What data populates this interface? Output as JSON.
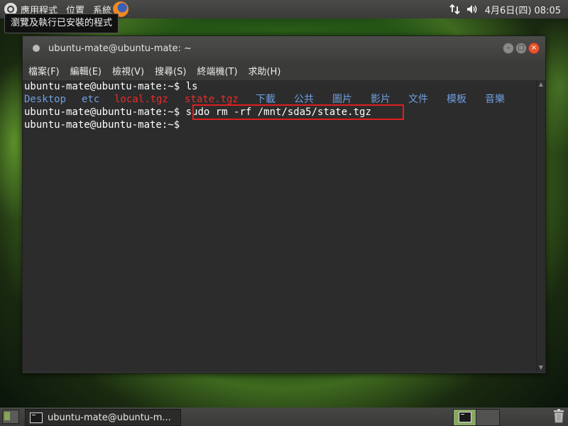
{
  "top_panel": {
    "menus": [
      "應用程式",
      "位置",
      "系統"
    ],
    "tooltip": "瀏覽及執行已安裝的程式",
    "clock": "4月6日(四) 08:05"
  },
  "window": {
    "title": "ubuntu-mate@ubuntu-mate: ~",
    "menu": [
      "檔案(F)",
      "編輯(E)",
      "檢視(V)",
      "搜尋(S)",
      "終端機(T)",
      "求助(H)"
    ]
  },
  "terminal": {
    "prompt": "ubuntu-mate@ubuntu-mate:~$",
    "cmd1": " ls",
    "ls_output": [
      {
        "name": "Desktop",
        "color": "#6f9fe0"
      },
      {
        "name": "etc",
        "color": "#6f9fe0"
      },
      {
        "name": "local.tgz",
        "color": "#ee2a2a"
      },
      {
        "name": "state.tgz",
        "color": "#ee2a2a"
      },
      {
        "name": "下載",
        "color": "#6f9fe0"
      },
      {
        "name": "公共",
        "color": "#6f9fe0"
      },
      {
        "name": "圖片",
        "color": "#6f9fe0"
      },
      {
        "name": "影片",
        "color": "#6f9fe0"
      },
      {
        "name": "文件",
        "color": "#6f9fe0"
      },
      {
        "name": "模板",
        "color": "#6f9fe0"
      },
      {
        "name": "音樂",
        "color": "#6f9fe0"
      }
    ],
    "cmd2": " sudo rm -rf /mnt/sda5/state.tgz",
    "cmd3": ""
  },
  "taskbar": {
    "task_label": "ubuntu-mate@ubuntu-m..."
  }
}
